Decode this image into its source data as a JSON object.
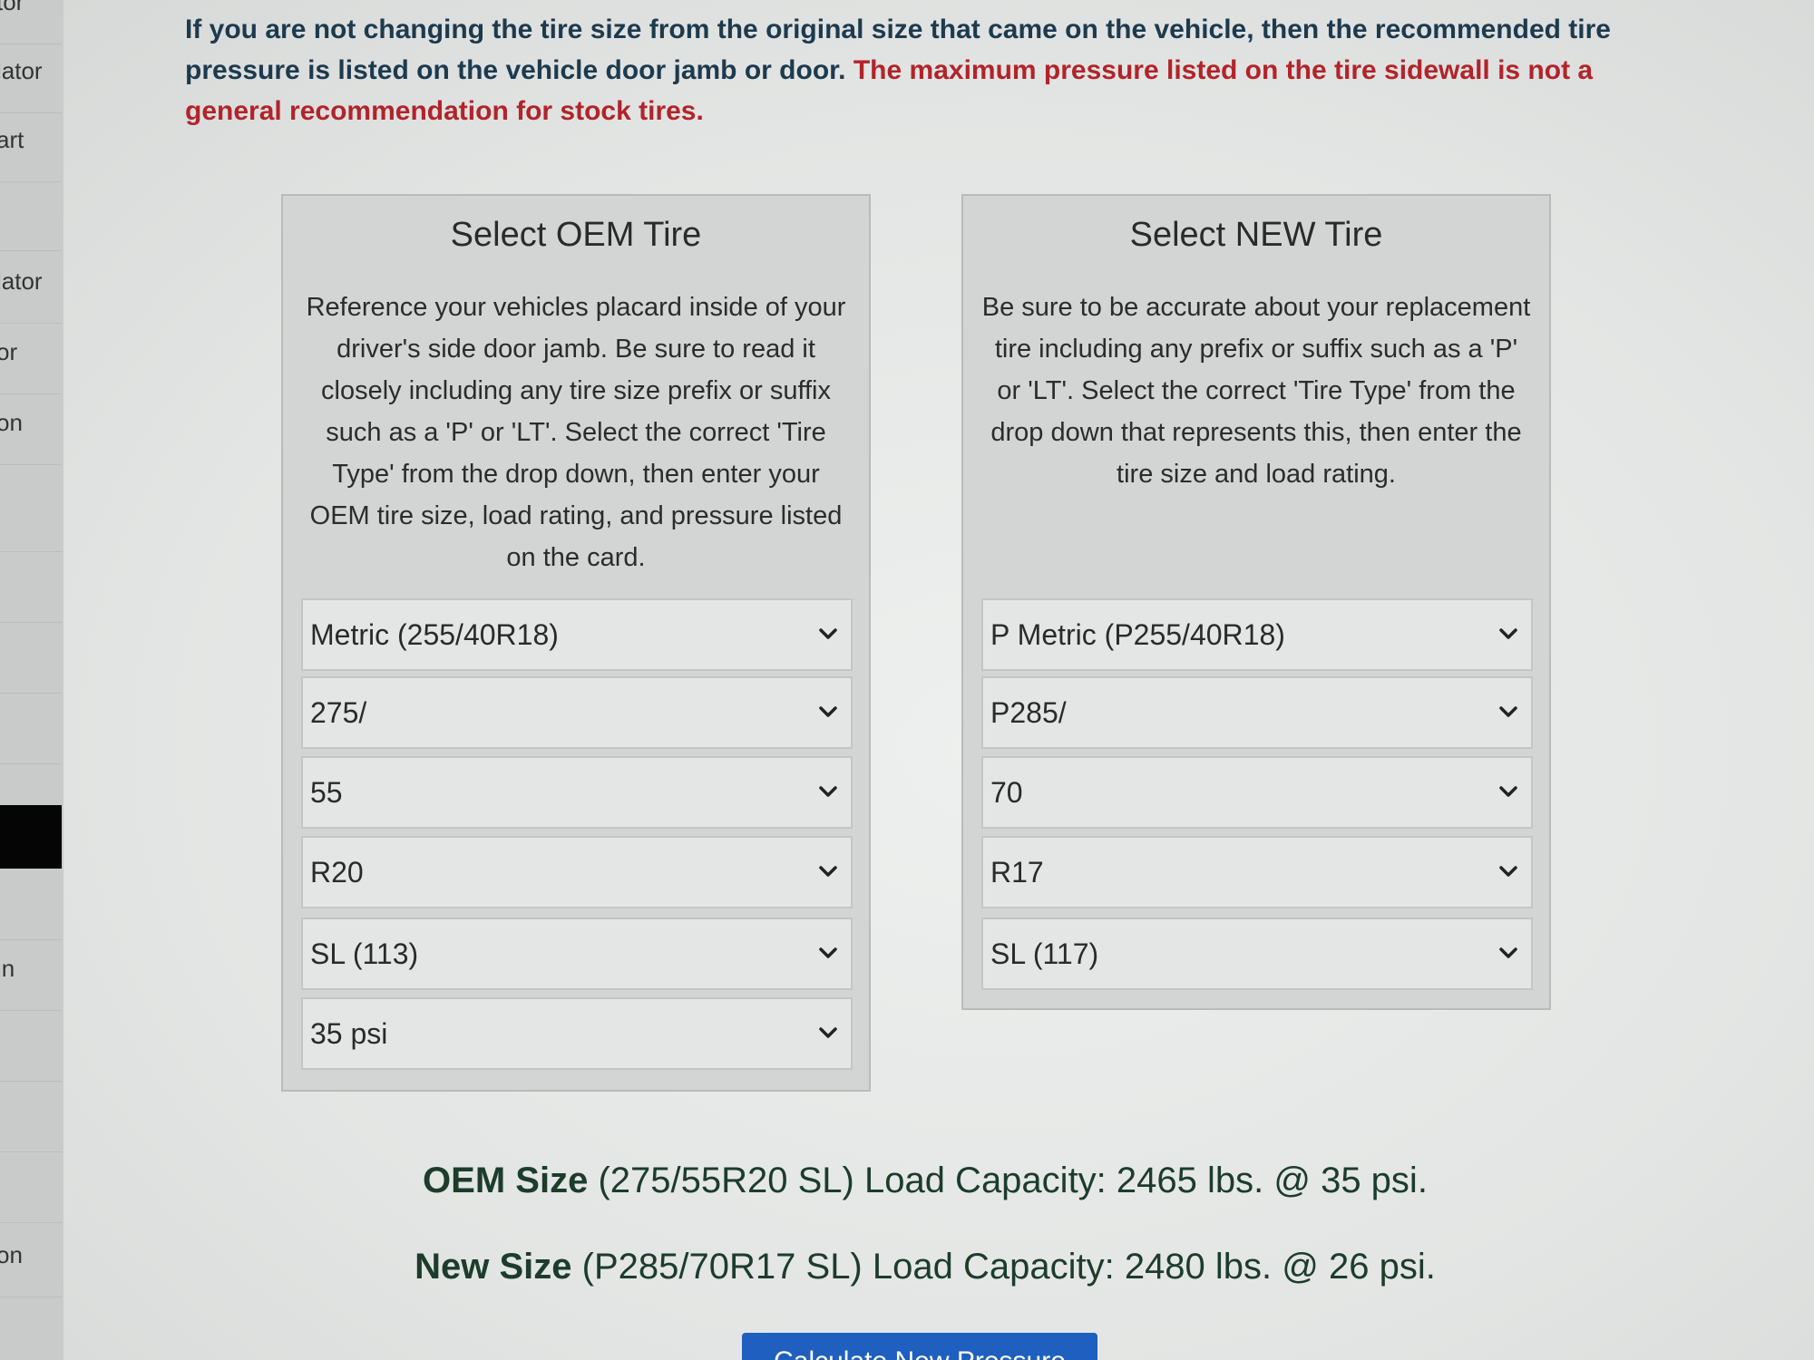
{
  "sidebar": {
    "items": [
      "tor",
      "lator",
      "art",
      "",
      "lator",
      "or",
      "on",
      "",
      "",
      "",
      "",
      "",
      "",
      "in",
      "",
      "",
      "",
      "on",
      ""
    ]
  },
  "notice": {
    "text": "If you are not changing the tire size from the original size that came on the vehicle, then the recommended tire pressure is listed on the vehicle door jamb or door.",
    "warning": "The maximum pressure listed on the tire sidewall is not a general recommendation for stock tires."
  },
  "oem": {
    "title": "Select OEM Tire",
    "description": "Reference your vehicles placard inside of your driver's side door jamb. Be sure to read it closely including any tire size prefix or suffix such as a 'P' or 'LT'. Select the correct 'Tire Type' from the drop down, then enter your OEM tire size, load rating, and pressure listed on the card.",
    "selects": {
      "tire_type": "Metric (255/40R18)",
      "width": "275/",
      "aspect": "55",
      "rim": "R20",
      "load": "SL (113)",
      "pressure": "35 psi"
    }
  },
  "new": {
    "title": "Select NEW Tire",
    "description": "Be sure to be accurate about your replacement tire including any prefix or suffix such as a 'P' or 'LT'. Select the correct 'Tire Type' from the drop down that represents this, then enter the tire size and load rating.",
    "selects": {
      "tire_type": "P Metric (P255/40R18)",
      "width": "P285/",
      "aspect": "70",
      "rim": "R17",
      "load": "SL (117)"
    }
  },
  "results": {
    "oem_label": "OEM Size",
    "oem_text": "(275/55R20 SL) Load Capacity: 2465 lbs. @ 35 psi.",
    "new_label": "New Size",
    "new_text": "(P285/70R17 SL) Load Capacity: 2480 lbs. @ 26 psi."
  },
  "button": {
    "label": "Calculate New Pressure"
  },
  "colors": {
    "notice_text": "#1d3a4e",
    "warning_text": "#b1242a",
    "button": "#1f5fbf"
  }
}
